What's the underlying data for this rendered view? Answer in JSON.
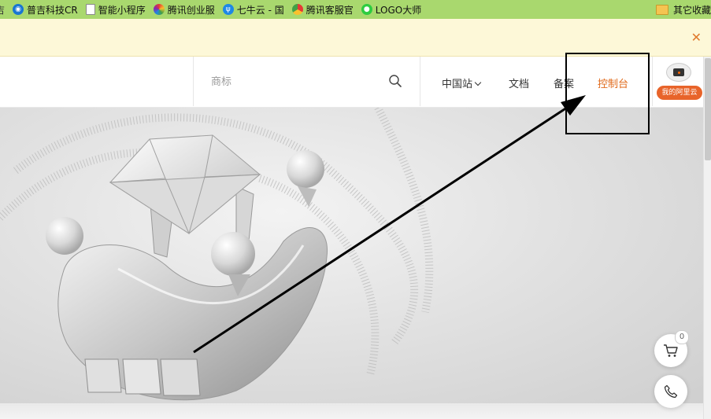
{
  "bookmarks": {
    "items": [
      {
        "label": "吉",
        "icon": "partial-bookmark-icon",
        "color": "#888888"
      },
      {
        "label": "普吉科技CR",
        "icon": "globe-icon",
        "color": "#1976d2"
      },
      {
        "label": "智能小程序",
        "icon": "document-icon",
        "color": "#ffffff"
      },
      {
        "label": "腾讯创业服",
        "icon": "colorful-circle-icon",
        "color": "#e53935"
      },
      {
        "label": "七牛云 - 国",
        "icon": "qiniu-icon",
        "color": "#1e88e5"
      },
      {
        "label": "腾讯客服官",
        "icon": "chrome-icon",
        "color": "#43a047"
      },
      {
        "label": "LOGO大师",
        "icon": "wechat-icon",
        "color": "#2ecc40"
      }
    ],
    "other": {
      "label": "其它收藏",
      "icon": "folder-icon"
    }
  },
  "notice": {
    "close_icon": "close-icon"
  },
  "header": {
    "search": {
      "placeholder": "商标"
    },
    "nav": {
      "station": "中国站",
      "docs": "文档",
      "record": "备案",
      "console": "控制台"
    },
    "account": {
      "label": "我的阿里云"
    }
  },
  "float": {
    "cart_count": "0"
  },
  "colors": {
    "bookmarks_bg": "#a9d86e",
    "notice_bg": "#fdf8d8",
    "accent": "#e06a1b",
    "account_badge": "#e8642a"
  }
}
